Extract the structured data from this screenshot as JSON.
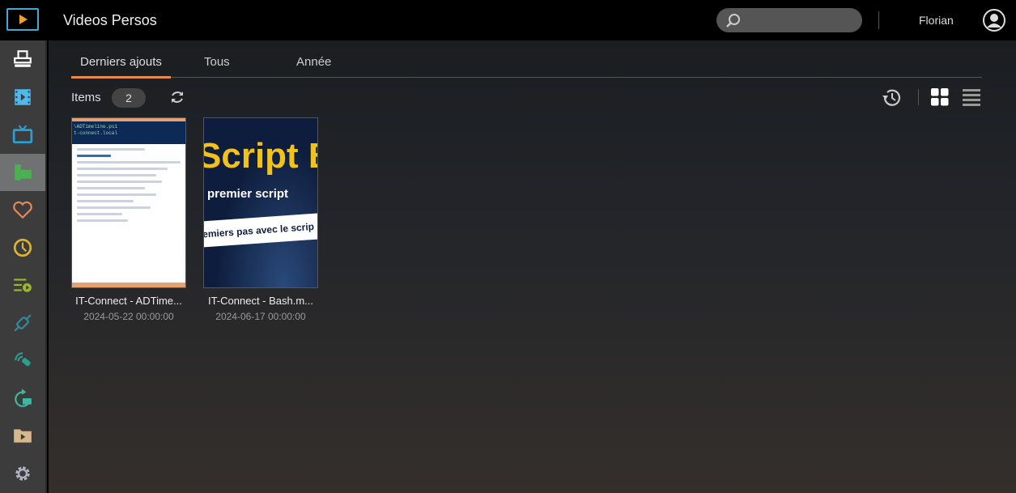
{
  "header": {
    "title": "Videos Persos",
    "user": "Florian",
    "search_placeholder": ""
  },
  "sidebar": {
    "items": [
      {
        "name": "dashboard",
        "color": "#ffffff"
      },
      {
        "name": "movies",
        "color": "#4fb8ec"
      },
      {
        "name": "tv-shows",
        "color": "#2a9fd0"
      },
      {
        "name": "personal-videos",
        "color": "#4caf50",
        "active": true
      },
      {
        "name": "favorites",
        "color": "#e48a56"
      },
      {
        "name": "recent",
        "color": "#d9b330"
      },
      {
        "name": "playlists",
        "color": "#9ab82a"
      },
      {
        "name": "connections",
        "color": "#2a8fa0"
      },
      {
        "name": "live-tv",
        "color": "#28a090"
      },
      {
        "name": "recordings",
        "color": "#3fb8a0"
      },
      {
        "name": "folders",
        "color": "#d7b88a"
      },
      {
        "name": "settings",
        "color": "#b0b0c0"
      }
    ]
  },
  "tabs": [
    {
      "label": "Derniers ajouts",
      "active": true
    },
    {
      "label": "Tous"
    },
    {
      "label": "Année"
    }
  ],
  "toolbar": {
    "items_label": "Items",
    "items_count": "2"
  },
  "videos": [
    {
      "title": "IT-Connect - ADTime...",
      "date": "2024-05-22 00:00:00",
      "thumb_text": [
        "\\ADTimeline.ps1",
        "t-connect.local"
      ]
    },
    {
      "title": "IT-Connect - Bash.m...",
      "date": "2024-06-17 00:00:00",
      "thumb_text": [
        "Script B",
        "premier script",
        "emiers pas avec le scrip"
      ]
    }
  ],
  "accent": "#e7894a"
}
